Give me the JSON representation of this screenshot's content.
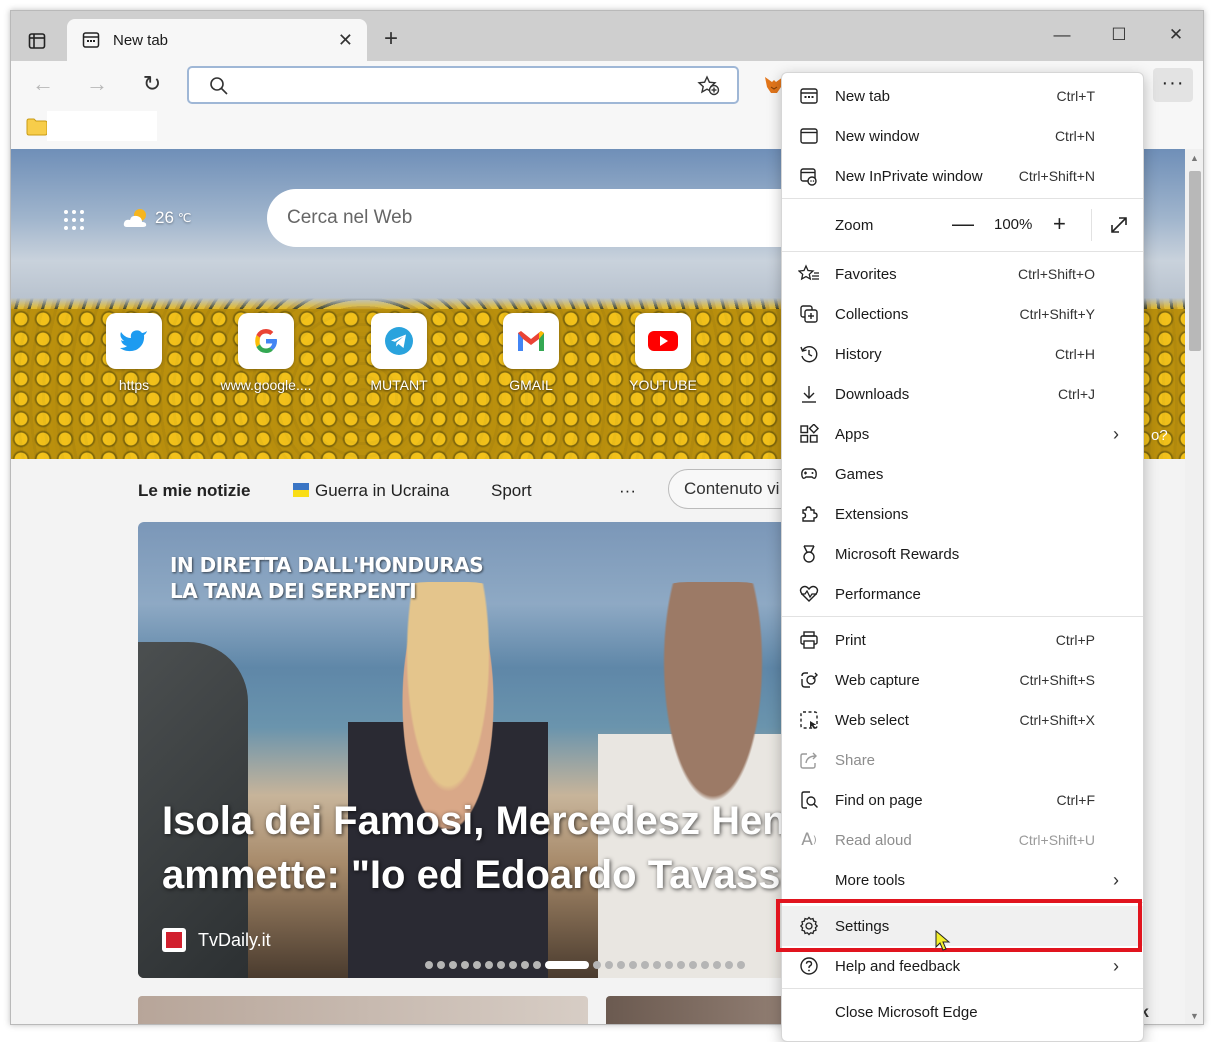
{
  "browser": {
    "tab_title": "New tab",
    "tab_close": "✕",
    "new_tab_symbol": "+",
    "window_controls": {
      "minimize": "—",
      "maximize": "☐",
      "close": "✕"
    }
  },
  "toolbar": {
    "back": "←",
    "forward": "→",
    "refresh": "↻",
    "address_value": "",
    "more": "···"
  },
  "newtab_page": {
    "weather_temp": "26",
    "weather_unit": "℃",
    "search_placeholder": "Cerca nel Web",
    "quick_links": [
      {
        "label": "https",
        "color": "#1d9bf0"
      },
      {
        "label": "www.google....",
        "color": "#4285f4"
      },
      {
        "label": "MUTANT",
        "color": "#2aa3dd"
      },
      {
        "label": "GMAIL",
        "color": "#ea4335"
      },
      {
        "label": "YOUTUBE",
        "color": "#ff0000"
      }
    ],
    "feed_tabs": [
      "Le mie notizie",
      "Guerra in Ucraina",
      "Sport",
      "···"
    ],
    "feed_pill": "Contenuto vi",
    "right_edge_text": "o?",
    "bottom_corner_text": "ck",
    "card": {
      "overlay_line1": "IN DIRETTA DALL'HONDURAS",
      "overlay_line2": "LA TANA DEI SERPENTI",
      "headline_line1": "Isola dei Famosi, Mercedesz Hen",
      "headline_line2": "ammette: \"Io ed Edoardo Tavassi",
      "source": "TvDaily.it"
    }
  },
  "menu": {
    "items": [
      {
        "name": "new-tab",
        "label": "New tab",
        "shortcut": "Ctrl+T",
        "icon": "new-tab-icon"
      },
      {
        "name": "new-window",
        "label": "New window",
        "shortcut": "Ctrl+N",
        "icon": "new-window-icon"
      },
      {
        "name": "new-inprivate-window",
        "label": "New InPrivate window",
        "shortcut": "Ctrl+Shift+N",
        "icon": "inprivate-icon"
      },
      {
        "name": "favorites",
        "label": "Favorites",
        "shortcut": "Ctrl+Shift+O",
        "icon": "favorites-icon"
      },
      {
        "name": "collections",
        "label": "Collections",
        "shortcut": "Ctrl+Shift+Y",
        "icon": "collections-icon"
      },
      {
        "name": "history",
        "label": "History",
        "shortcut": "Ctrl+H",
        "icon": "history-icon"
      },
      {
        "name": "downloads",
        "label": "Downloads",
        "shortcut": "Ctrl+J",
        "icon": "download-icon"
      },
      {
        "name": "apps",
        "label": "Apps",
        "shortcut": "",
        "icon": "apps-icon"
      },
      {
        "name": "games",
        "label": "Games",
        "shortcut": "",
        "icon": "games-icon"
      },
      {
        "name": "extensions",
        "label": "Extensions",
        "shortcut": "",
        "icon": "extensions-icon"
      },
      {
        "name": "microsoft-rewards",
        "label": "Microsoft Rewards",
        "shortcut": "",
        "icon": "rewards-icon"
      },
      {
        "name": "performance",
        "label": "Performance",
        "shortcut": "",
        "icon": "performance-icon"
      },
      {
        "name": "print",
        "label": "Print",
        "shortcut": "Ctrl+P",
        "icon": "print-icon"
      },
      {
        "name": "web-capture",
        "label": "Web capture",
        "shortcut": "Ctrl+Shift+S",
        "icon": "web-capture-icon"
      },
      {
        "name": "web-select",
        "label": "Web select",
        "shortcut": "Ctrl+Shift+X",
        "icon": "web-select-icon"
      },
      {
        "name": "share",
        "label": "Share",
        "shortcut": "",
        "icon": "share-icon"
      },
      {
        "name": "find-on-page",
        "label": "Find on page",
        "shortcut": "Ctrl+F",
        "icon": "find-icon"
      },
      {
        "name": "read-aloud",
        "label": "Read aloud",
        "shortcut": "Ctrl+Shift+U",
        "icon": "read-aloud-icon"
      },
      {
        "name": "more-tools",
        "label": "More tools",
        "shortcut": "",
        "icon": "more-tools-icon"
      },
      {
        "name": "settings",
        "label": "Settings",
        "shortcut": "",
        "icon": "gear-icon"
      },
      {
        "name": "help-and-feedback",
        "label": "Help and feedback",
        "shortcut": "",
        "icon": "help-icon"
      },
      {
        "name": "close-microsoft-edge",
        "label": "Close Microsoft Edge",
        "shortcut": "",
        "icon": ""
      }
    ],
    "zoom": {
      "label": "Zoom",
      "minus": "—",
      "value": "100%",
      "plus": "+"
    },
    "submenu_chevron": "›"
  },
  "colors": {
    "highlight_box": "#e1141e",
    "menu_hover": "#f0f0f0",
    "address_border": "#9fb7d6"
  }
}
